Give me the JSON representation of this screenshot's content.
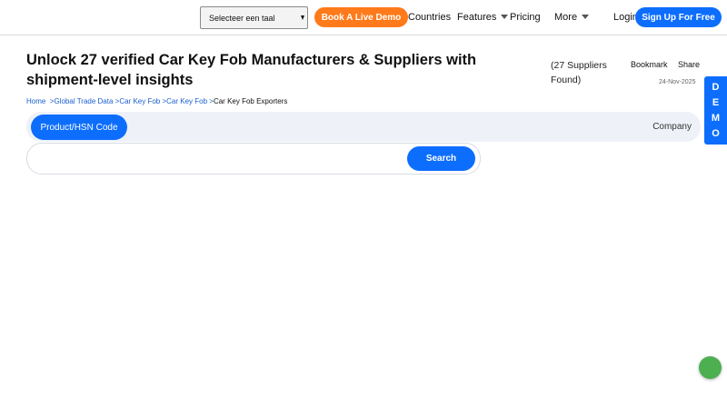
{
  "header": {
    "language_select": "Selecteer een taal",
    "book_demo_label": "Book A Live Demo",
    "nav": {
      "countries": "Countries",
      "features": "Features",
      "pricing": "Pricing",
      "more": "More"
    },
    "login_label": "Login",
    "signup_label": "Sign Up For Free"
  },
  "page": {
    "title": "Unlock 27 verified Car Key Fob Manufacturers & Suppliers with shipment-level insights",
    "supplier_count": "(27 Suppliers Found)",
    "bookmark_label": "Bookmark",
    "share_label": "Share",
    "date": "24-Nov-2025"
  },
  "demo_tab": {
    "letters": [
      "D",
      "E",
      "M",
      "O"
    ]
  },
  "breadcrumb": {
    "items": [
      "Home",
      "Global Trade Data",
      "Car Key Fob",
      "Car Key Fob"
    ],
    "current": "Car Key Fob Exporters"
  },
  "search": {
    "tab_hsn": "Product/HSN Code",
    "tab_company": "Company",
    "input_value": "",
    "input_placeholder": "",
    "button_label": "Search"
  },
  "icons": {
    "caret": "chevron-down-icon",
    "chat": "chat-icon"
  },
  "colors": {
    "primary": "#0d6efd",
    "accent_orange": "#ff7a1a",
    "chat_green": "#4caf50",
    "search_bar_bg": "#eef2f8"
  }
}
